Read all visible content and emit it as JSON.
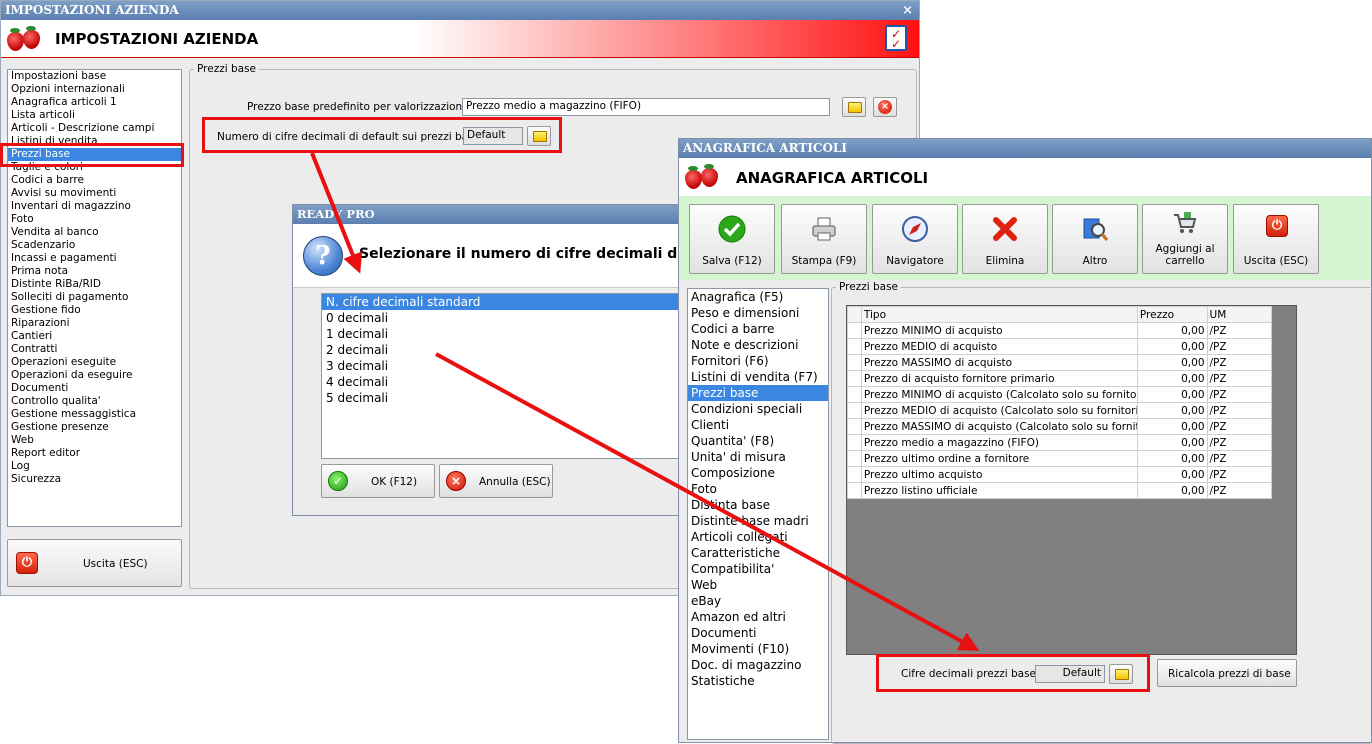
{
  "win1": {
    "titlebar": "IMPOSTAZIONI AZIENDA",
    "header_title": "IMPOSTAZIONI AZIENDA",
    "close": "×",
    "sidebar": [
      "Impostazioni base",
      "Opzioni internazionali",
      "Anagrafica articoli 1",
      "Lista articoli",
      "Articoli - Descrizione campi",
      "Listini di vendita",
      "Prezzi base",
      "Taglie e colori",
      "Codici a barre",
      "Avvisi su movimenti",
      "Inventari di magazzino",
      "Foto",
      "Vendita al banco",
      "Scadenzario",
      "Incassi e pagamenti",
      "Prima nota",
      "Distinte RiBa/RID",
      "Solleciti di pagamento",
      "Gestione fido",
      "Riparazioni",
      "Cantieri",
      "Contratti",
      "Operazioni eseguite",
      "Operazioni da eseguire",
      "Documenti",
      "Controllo qualita'",
      "Gestione messaggistica",
      "Gestione presenze",
      "Web",
      "Report editor",
      "Log",
      "Sicurezza"
    ],
    "selected_item": "Prezzi base",
    "exit_button": "Uscita (ESC)",
    "group_label": "Prezzi base",
    "field1_label": "Prezzo base predefinito per valorizzazione :",
    "field1_value": "Prezzo medio a magazzino (FIFO)",
    "field2_label": "Numero di cifre decimali di default sui prezzi base :",
    "field2_value": "Default"
  },
  "win2": {
    "titlebar": "READY PRO",
    "question": "Selezionare il numero di cifre decimali da u",
    "options": [
      "N. cifre decimali standard",
      "0 decimali",
      "1 decimali",
      "2 decimali",
      "3 decimali",
      "4 decimali",
      "5 decimali"
    ],
    "ok_button": "OK (F12)",
    "cancel_button": "Annulla (ESC)"
  },
  "win3": {
    "titlebar": "ANAGRAFICA ARTICOLI",
    "header_title": "ANAGRAFICA ARTICOLI",
    "toolbar": [
      "Salva (F12)",
      "Stampa (F9)",
      "Navigatore",
      "Elimina",
      "Altro",
      "Aggiungi al carrello",
      "Uscita (ESC)"
    ],
    "sidebar": [
      "Anagrafica (F5)",
      "Peso e dimensioni",
      "Codici a barre",
      "Note e descrizioni",
      "Fornitori (F6)",
      "Listini di vendita (F7)",
      "Prezzi base",
      "Condizioni speciali",
      "Clienti",
      "Quantita' (F8)",
      "Unita' di misura",
      "Composizione",
      "Foto",
      "Distinta base",
      "Distinte base madri",
      "Articoli collegati",
      "Caratteristiche",
      "Compatibilita'",
      "Web",
      "eBay",
      "Amazon ed altri",
      "Documenti",
      "Movimenti (F10)",
      "Doc. di magazzino",
      "Statistiche"
    ],
    "selected_item": "Prezzi base",
    "group_label": "Prezzi base",
    "columns": [
      "Tipo",
      "Prezzo",
      "UM"
    ],
    "rows": [
      [
        "Prezzo MINIMO di acquisto",
        "0,00",
        "/PZ"
      ],
      [
        "Prezzo MEDIO di acquisto",
        "0,00",
        "/PZ"
      ],
      [
        "Prezzo MASSIMO di acquisto",
        "0,00",
        "/PZ"
      ],
      [
        "Prezzo di acquisto fornitore primario",
        "0,00",
        "/PZ"
      ],
      [
        "Prezzo MINIMO di acquisto (Calcolato solo su fornitori con",
        "0,00",
        "/PZ"
      ],
      [
        "Prezzo MEDIO di acquisto (Calcolato solo su fornitori con",
        "0,00",
        "/PZ"
      ],
      [
        "Prezzo MASSIMO di acquisto (Calcolato solo su fornitori c",
        "0,00",
        "/PZ"
      ],
      [
        "Prezzo medio a magazzino (FIFO)",
        "0,00",
        "/PZ"
      ],
      [
        "Prezzo ultimo ordine a fornitore",
        "0,00",
        "/PZ"
      ],
      [
        "Prezzo ultimo acquisto",
        "0,00",
        "/PZ"
      ],
      [
        "Prezzo listino ufficiale",
        "0,00",
        "/PZ"
      ]
    ],
    "decimals_label": "Cifre decimali prezzi base :",
    "decimals_value": "Default",
    "recalc_button": "Ricalcola prezzi di base"
  },
  "colors": {
    "highlight": "#e81010",
    "selection": "#3a86e0",
    "toolbar_bg": "#d4f5d0"
  }
}
